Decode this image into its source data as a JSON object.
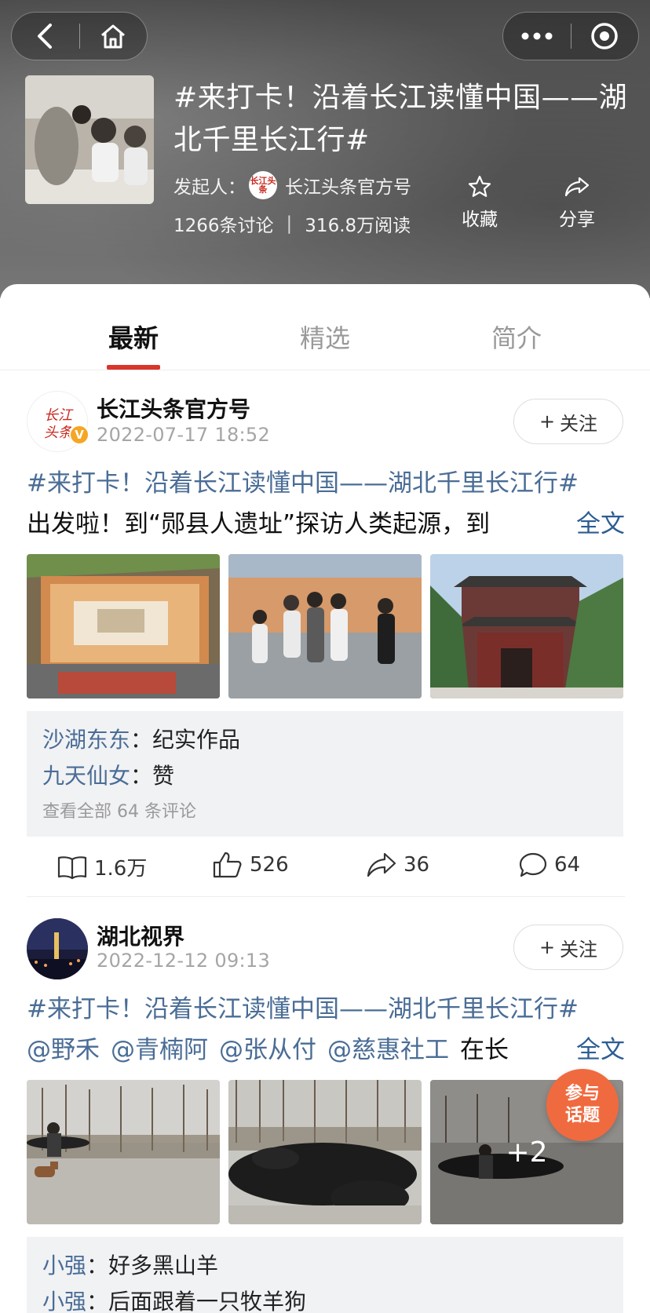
{
  "header": {
    "topic_title": "#来打卡！沿着长江读懂中国——湖北千里长江行#",
    "initiator_label": "发起人：",
    "initiator_name": "长江头条官方号",
    "initiator_avatar_text": "长江头条",
    "discussions": "1266条讨论",
    "separator": "|",
    "reads": "316.8万阅读",
    "favorite_label": "收藏",
    "share_label": "分享"
  },
  "tabs": [
    {
      "label": "最新",
      "active": true
    },
    {
      "label": "精选",
      "active": false
    },
    {
      "label": "简介",
      "active": false
    }
  ],
  "posts": [
    {
      "author": "长江头条官方号",
      "avatar_text": "长江头条",
      "verified": true,
      "time": "2022-07-17 18:52",
      "follow_label": "关注",
      "hashtag": "#来打卡！沿着长江读懂中国——湖北千里长江行#",
      "text": "出发啦！到“郧县人遗址”探访人类起源，到",
      "more": "全文",
      "comments": [
        {
          "user": "沙湖东东",
          "sep": "：",
          "text": "纪实作品"
        },
        {
          "user": "九天仙女",
          "sep": "：",
          "text": "赞"
        }
      ],
      "view_all": "查看全部 64 条评论",
      "stats": {
        "reads": "1.6万",
        "likes": "526",
        "shares": "36",
        "comments": "64"
      }
    },
    {
      "author": "湖北视界",
      "time": "2022-12-12 09:13",
      "follow_label": "关注",
      "hashtag": "#来打卡！沿着长江读懂中国——湖北千里长江行#",
      "mentions": [
        "@野禾",
        "@青楠阿",
        "@张从付",
        "@慈惠社工"
      ],
      "text_tail": "在长",
      "more": "全文",
      "extra_images": "+2",
      "comments": [
        {
          "user": "小强",
          "sep": "：",
          "text": "好多黑山羊"
        },
        {
          "user": "小强",
          "sep": "：",
          "text": "后面跟着一只牧羊狗"
        }
      ]
    }
  ],
  "join_button": {
    "line1": "参与",
    "line2": "话题"
  },
  "colors": {
    "accent_red": "#d9352b",
    "link_blue": "#4a6d96",
    "join_orange": "#f06a3f"
  }
}
